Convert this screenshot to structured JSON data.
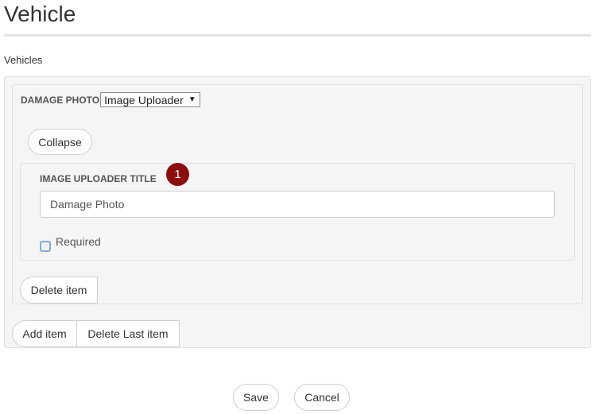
{
  "page": {
    "title": "Vehicle",
    "section_label": "Vehicles"
  },
  "item": {
    "field_label": "DAMAGE PHOTO",
    "select_value": "Image Uploader",
    "collapse_label": "Collapse",
    "delete_item_label": "Delete item"
  },
  "uploader": {
    "title_label": "IMAGE UPLOADER TITLE",
    "badge": "1",
    "title_value": "Damage Photo",
    "required_label": "Required",
    "required_checked": false
  },
  "list_actions": {
    "add_item_label": "Add item",
    "delete_last_label": "Delete Last item"
  },
  "form_actions": {
    "save_label": "Save",
    "cancel_label": "Cancel"
  },
  "colors": {
    "badge": "#8b0d0d",
    "panel_bg": "#f5f5f5",
    "panel_border": "#e0e0e0"
  }
}
